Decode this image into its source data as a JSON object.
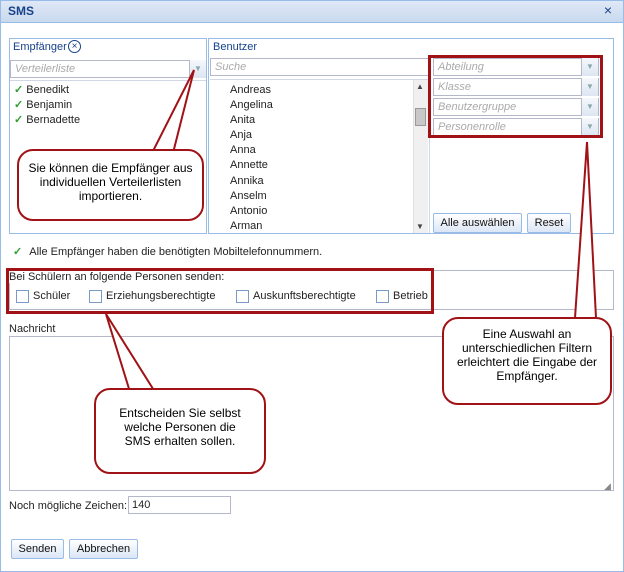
{
  "dialog": {
    "title": "SMS"
  },
  "recipients": {
    "header": "Empfänger",
    "distribution_placeholder": "Verteilerliste",
    "items": [
      "Benedikt",
      "Benjamin",
      "Bernadette"
    ]
  },
  "users": {
    "header": "Benutzer",
    "search_placeholder": "Suche",
    "items": [
      "Andreas",
      "Angelina",
      "Anita",
      "Anja",
      "Anna",
      "Annette",
      "Annika",
      "Anselm",
      "Antonio",
      "Arman"
    ]
  },
  "filters": {
    "department": "Abteilung",
    "class": "Klasse",
    "user_group": "Benutzergruppe",
    "person_role": "Personenrolle",
    "select_all": "Alle auswählen",
    "reset": "Reset"
  },
  "status_text": "Alle Empfänger haben die benötigten Mobiltelefonnummern.",
  "students": {
    "legend": "Bei Schülern an folgende Personen senden:",
    "options": [
      "Schüler",
      "Erziehungsberechtigte",
      "Auskunftsberechtigte",
      "Betrieb"
    ]
  },
  "message": {
    "label": "Nachricht",
    "value": ""
  },
  "chars": {
    "label": "Noch mögliche Zeichen:",
    "value": "140"
  },
  "buttons": {
    "send": "Senden",
    "cancel": "Abbrechen"
  },
  "callouts": {
    "import": "Sie können die Empfänger aus individuellen Verteilerlisten importieren.",
    "filters": "Eine Auswahl an unterschiedlichen Filtern erleichtert die Eingabe der Empfänger.",
    "persons": "Entscheiden Sie selbst welche Personen die SMS erhalten sollen."
  },
  "colors": {
    "annotation": "#a01216",
    "header_text": "#15428b",
    "check": "#2e9e2e"
  }
}
